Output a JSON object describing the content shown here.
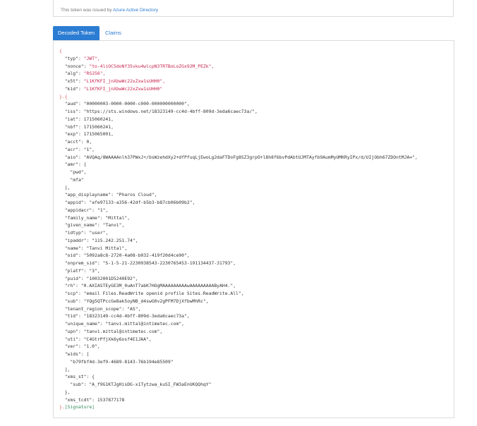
{
  "issuer_notice": {
    "prefix": "This token was issued by ",
    "issuer": "Azure Active Directory"
  },
  "tabs": [
    {
      "label": "Decoded Token",
      "active": true
    },
    {
      "label": "Claims",
      "active": false
    }
  ],
  "header": [
    {
      "key": "\"typ\"",
      "value": "\"JWT\","
    },
    {
      "key": "\"nonce\"",
      "value": "\"to-4liOC5doNf35vku4wlcpN3TRTBoLoZGx92M_PEZk\","
    },
    {
      "key": "\"alg\"",
      "value": "\"RS256\","
    },
    {
      "key": "\"x5t\"",
      "value": "\"L1KfKFI_jnXbwWc22xZxw1sUHH0\","
    },
    {
      "key": "\"kid\"",
      "value": "\"L1KfKFI_jnXbwWc22xZxw1sUHH0\""
    }
  ],
  "separator": "}.{",
  "payload": [
    "\"aud\": \"00000003-0000-0000-c000-000000000000\",",
    "\"iss\": \"https://sts.windows.net/18323149-cc4d-4bff-809d-3eda6caec73a/\",",
    "\"iat\": 1715060241,",
    "\"nbf\": 1715060241,",
    "\"exp\": 1715065001,",
    "\"acct\": 0,",
    "\"acr\": \"1\",",
    "\"aio\": \"AVQAq/8WAAAAnlh37PWxJ+/bsWzehdXy2+dfPfuqLjEwoLg2daFTDoFg8SZ3grpO+l8h8f6bvPdAbtUJMTAyfb9AumMyUMKRyIPx/d/UIjObh67ZDOntMJA=\",",
    "\"amr\": [",
    "  \"pwd\",",
    "  \"mfa\"",
    "],",
    "\"app_displayname\": \"Pharos Cloud\",",
    "\"appid\": \"afe97133-a356-42df-b5b3-b87cb06b09b2\",",
    "\"appidacr\": \"1\",",
    "\"family_name\": \"Mittal\",",
    "\"given_name\": \"Tanvi\",",
    "\"idtyp\": \"user\",",
    "\"ipaddr\": \"115.242.251.74\",",
    "\"name\": \"Tanvi Mittal\",",
    "\"oid\": \"5092a8c8-2720-4a08-b032-419f20d4ce90\",",
    "\"onprem_sid\": \"S-1-5-21-2230938543-2230765453-191134437-31793\",",
    "\"platf\": \"3\",",
    "\"puid\": \"10032001D5240E92\",",
    "\"rh\": \"0.AXIASTEyGE3M_0uAnT7abK7HOgMAAAAAAAAAwAAAAAAAAAByAH4.\",",
    "\"scp\": \"email Files.ReadWrite openid profile Sites.ReadWrite.All\",",
    "\"sub\": \"YQg5QTPccGe8ak5oyNB_d4swG0v2gPFM7DjXfbwMhRc\",",
    "\"tenant_region_scope\": \"AS\",",
    "\"tid\": \"18323149-cc4d-4bff-809d-3eda6caec73a\",",
    "\"unique_name\": \"tanvi.mittal@intimetec.com\",",
    "\"upn\": \"tanvi.mittal@intimetec.com\",",
    "\"uti\": \"C4GtrPfjXk6y6osf4E1JAA\",",
    "\"ver\": \"1.0\",",
    "\"wids\": [",
    "  \"b79fbf4d-3ef9-4689-8143-76b194e85509\"",
    "],",
    "\"xms_st\": {",
    "  \"sub\": \"A_f9G1KTJgHisDG-x1Tytzwa_kuSI_FW3aEnUKQQhqY\"",
    "},",
    "\"xms_tcdt\": 1537877178"
  ],
  "footer_prefix": "}.",
  "signature": "[Signature]",
  "colors": {
    "accent": "#2b7cd3",
    "brace": "#d9534f",
    "header_value": "#c7254e",
    "signature": "#2e8b57"
  }
}
